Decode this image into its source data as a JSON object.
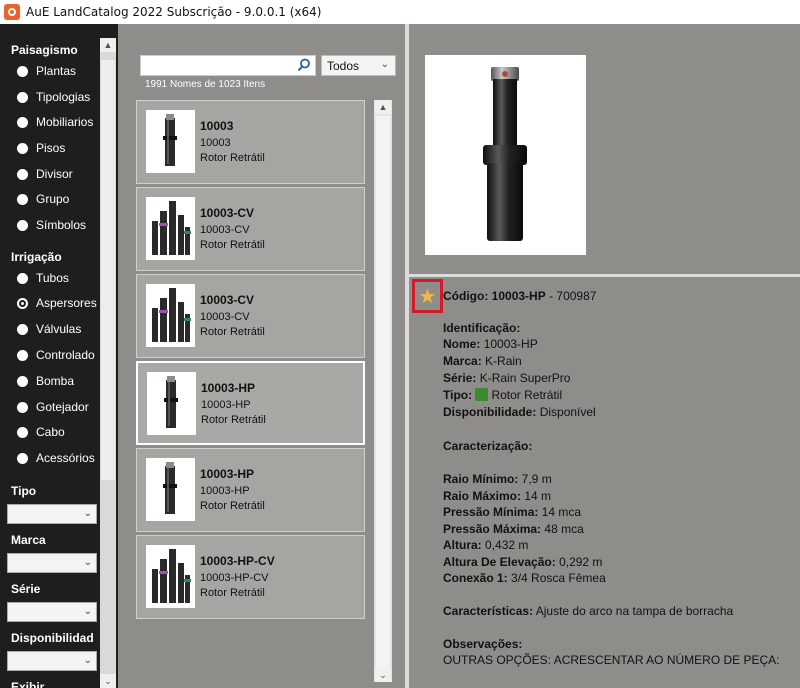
{
  "window": {
    "title": "AuE LandCatalog 2022 Subscrição - 9.0.0.1 (x64)"
  },
  "sidebar": {
    "sections": [
      {
        "title": "Paisagismo",
        "items": [
          "Plantas",
          "Tipologias",
          "Mobiliarios",
          "Pisos",
          "Divisor",
          "Grupo",
          "Símbolos"
        ]
      },
      {
        "title": "Irrigação",
        "items": [
          "Tubos",
          "Aspersores",
          "Válvulas",
          "Controlado",
          "Bomba",
          "Gotejador",
          "Cabo",
          "Acessórios"
        ]
      }
    ],
    "selected_item": "Aspersores",
    "filters": [
      "Tipo",
      "Marca",
      "Série",
      "Disponibilidad",
      "Exibir"
    ]
  },
  "search": {
    "value": "",
    "filter_selected": "Todos",
    "count_text": "1991 Nomes de 1023 Itens"
  },
  "items": [
    {
      "code": "10003",
      "sub": "10003",
      "type": "Rotor Retrátil"
    },
    {
      "code": "10003-CV",
      "sub": "10003-CV",
      "type": "Rotor Retrátil"
    },
    {
      "code": "10003-CV",
      "sub": "10003-CV",
      "type": "Rotor Retrátil"
    },
    {
      "code": "10003-HP",
      "sub": "10003-HP",
      "type": "Rotor Retrátil"
    },
    {
      "code": "10003-HP",
      "sub": "10003-HP",
      "type": "Rotor Retrátil"
    },
    {
      "code": "10003-HP-CV",
      "sub": "10003-HP-CV",
      "type": "Rotor Retrátil"
    }
  ],
  "selected_index": 3,
  "details": {
    "code_label": "Código:",
    "code": "10003-HP",
    "code_suffix": "- 700987",
    "identificacao": "Identificação:",
    "nome_label": "Nome:",
    "nome": "10003-HP",
    "marca_label": "Marca:",
    "marca": "K-Rain",
    "serie_label": "Série:",
    "serie": "K-Rain SuperPro",
    "tipo_label": "Tipo:",
    "tipo": "Rotor Retrátil",
    "disp_label": "Disponibilidade:",
    "disp": "Disponível",
    "caracterizacao": "Caracterização:",
    "raio_min_label": "Raio Mínimo:",
    "raio_min": "7,9 m",
    "raio_max_label": "Raio Máximo:",
    "raio_max": "14 m",
    "pressao_min_label": "Pressão Mínima:",
    "pressao_min": "14 mca",
    "pressao_max_label": "Pressão Máxima:",
    "pressao_max": "48 mca",
    "altura_label": "Altura:",
    "altura": "0,432 m",
    "altura_elev_label": "Altura De Elevação:",
    "altura_elev": "0,292 m",
    "conexao_label": "Conexão 1:",
    "conexao": "3/4 Rosca Fêmea",
    "caracteristicas_label": "Características:",
    "caracteristicas": "Ajuste do arco na tampa de borracha",
    "observacoes_label": "Observações:",
    "observacoes": "OUTRAS OPÇÕES: ACRESCENTAR AO NÚMERO DE PEÇA:"
  },
  "colors": {
    "favorite_border": "#d21a2a",
    "star": "#f2b84b",
    "sidebar_bg": "#1e1e1e",
    "panel_bg": "#8f8d89"
  },
  "icons": {
    "favorite": "star-icon",
    "search": "search-icon",
    "type": "rotor-type-icon"
  }
}
